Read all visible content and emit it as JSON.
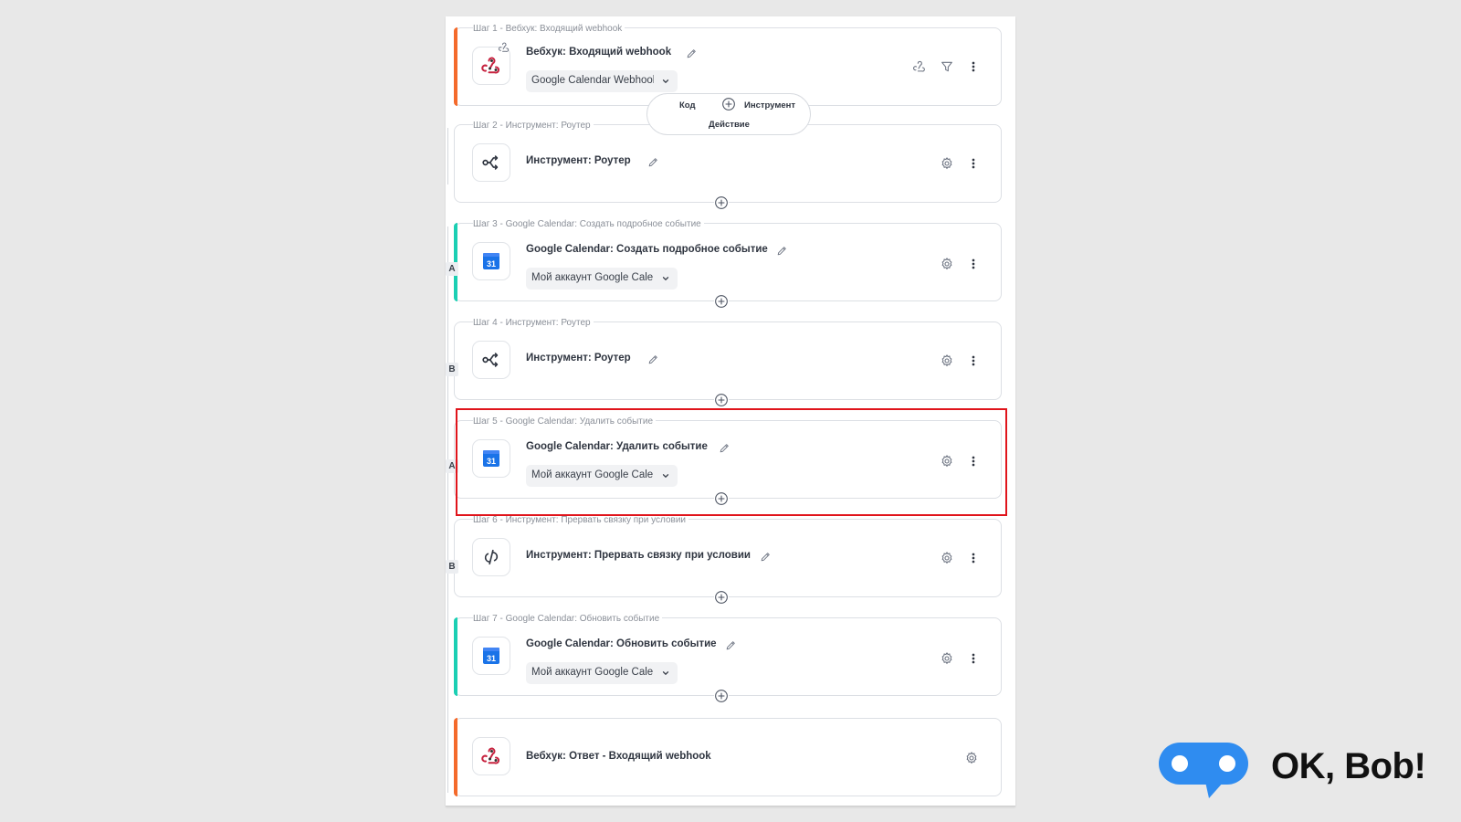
{
  "steps": [
    {
      "label": "Шаг 1 - Вебхук: Входящий webhook",
      "title": "Вебхук: Входящий webhook",
      "dropdown": "Google Calendar Webhook"
    },
    {
      "label": "Шаг 2 - Инструмент: Роутер",
      "title": "Инструмент: Роутер"
    },
    {
      "label": "Шаг 3 - Google Calendar: Создать подробное событие",
      "title": "Google Calendar: Создать подробное событие",
      "dropdown": "Мой аккаунт Google Calendar",
      "branch": "A"
    },
    {
      "label": "Шаг 4 - Инструмент: Роутер",
      "title": "Инструмент: Роутер",
      "branch": "B"
    },
    {
      "label": "Шаг 5 - Google Calendar: Удалить событие",
      "title": "Google Calendar: Удалить событие",
      "dropdown": "Мой аккаунт Google Calendar",
      "branch": "A"
    },
    {
      "label": "Шаг 6 - Инструмент: Прервать связку при условии",
      "title": "Инструмент: Прервать связку при условии",
      "branch": "B"
    },
    {
      "label": "Шаг 7 - Google Calendar: Обновить событие",
      "title": "Google Calendar: Обновить событие",
      "dropdown": "Мой аккаунт Google Calendar"
    },
    {
      "title": "Вебхук: Ответ - Входящий webhook"
    }
  ],
  "calendar_day": "31",
  "add_menu": {
    "code": "Код",
    "tool": "Инструмент",
    "action": "Действие"
  },
  "brand": {
    "name": "OK, Bob!",
    "color": "#2f8cf0"
  },
  "colors": {
    "webhook_accent": "#f46a2b",
    "calendar_accent": "#1bcfb3",
    "highlight": "#e0141b"
  },
  "icons": {
    "webhook": "webhook-icon",
    "router": "router-icon",
    "calendar": "google-calendar-icon",
    "stop": "break-chain-icon",
    "gear": "gear-icon",
    "more": "kebab-menu-icon",
    "filter": "filter-icon",
    "pencil": "pencil-icon",
    "plus": "plus-circle-icon"
  }
}
